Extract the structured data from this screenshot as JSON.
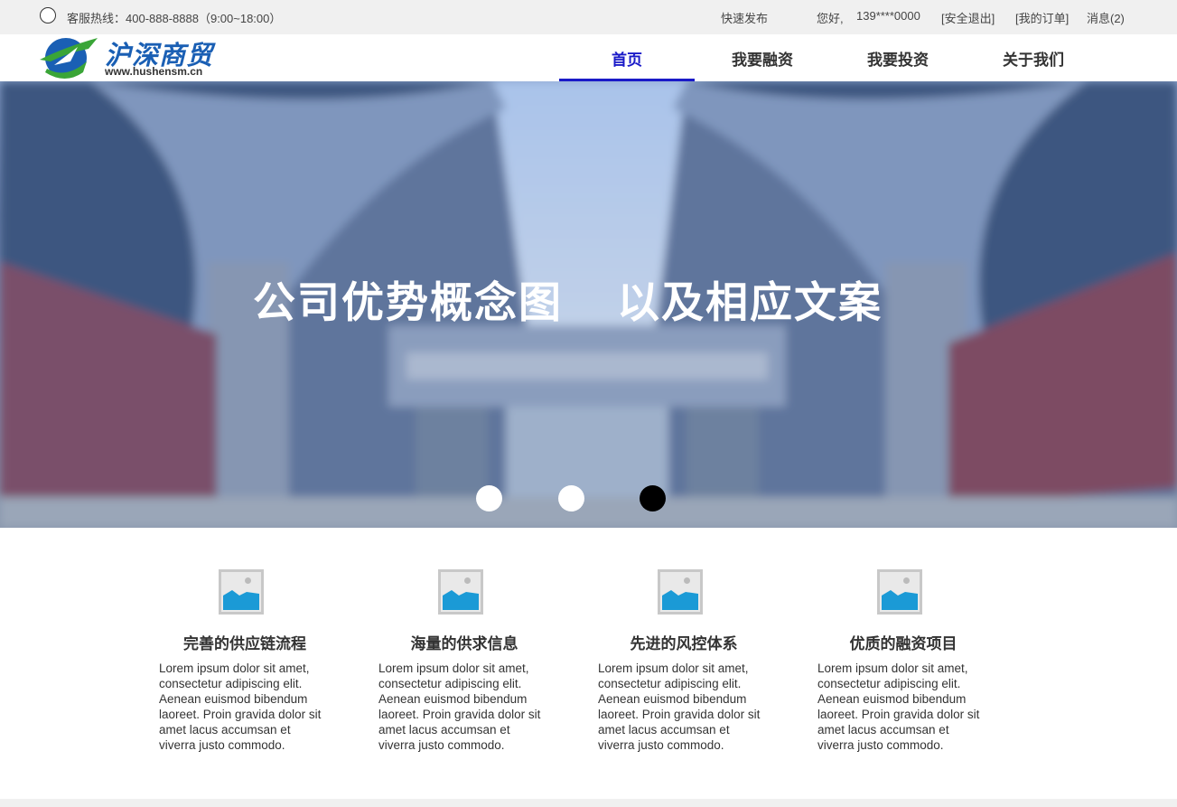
{
  "topbar": {
    "hotline": "客服热线：400-888-8888（9:00~18:00）",
    "quick_publish": "快速发布",
    "greeting": "您好,",
    "phone_masked": "139****0000",
    "logout": "[安全退出]",
    "orders": "[我的订单]",
    "messages": "消息(2)"
  },
  "header": {
    "logo_name": "沪深商贸",
    "logo_url": "www.hushensm.cn",
    "nav": [
      {
        "label": "首页",
        "active": true
      },
      {
        "label": "我要融资",
        "active": false
      },
      {
        "label": "我要投资",
        "active": false
      },
      {
        "label": "关于我们",
        "active": false
      }
    ]
  },
  "banner": {
    "title_part1": "公司优势概念图",
    "title_part2": "以及相应文案",
    "slides": 3,
    "active_slide": 3
  },
  "features": [
    {
      "title": "完善的供应链流程",
      "text": "Lorem ipsum dolor sit amet, consectetur adipiscing elit. Aenean euismod bibendum laoreet. Proin gravida dolor sit amet lacus accumsan et viverra justo commodo.",
      "icon": "image-placeholder-icon"
    },
    {
      "title": "海量的供求信息",
      "text": "Lorem ipsum dolor sit amet, consectetur adipiscing elit. Aenean euismod bibendum laoreet. Proin gravida dolor sit amet lacus accumsan et viverra justo commodo.",
      "icon": "image-placeholder-icon"
    },
    {
      "title": "先进的风控体系",
      "text": "Lorem ipsum dolor sit amet, consectetur adipiscing elit. Aenean euismod bibendum laoreet. Proin gravida dolor sit amet lacus accumsan et viverra justo commodo.",
      "icon": "image-placeholder-icon"
    },
    {
      "title": "优质的融资项目",
      "text": "Lorem ipsum dolor sit amet, consectetur adipiscing elit. Aenean euismod bibendum laoreet. Proin gravida dolor sit amet lacus accumsan et viverra justo commodo.",
      "icon": "image-placeholder-icon"
    }
  ],
  "colors": {
    "accent": "#1a1ac8",
    "logo_blue": "#1a5fb4",
    "logo_green": "#3aa537",
    "topbar_bg": "#f0f0f0"
  }
}
